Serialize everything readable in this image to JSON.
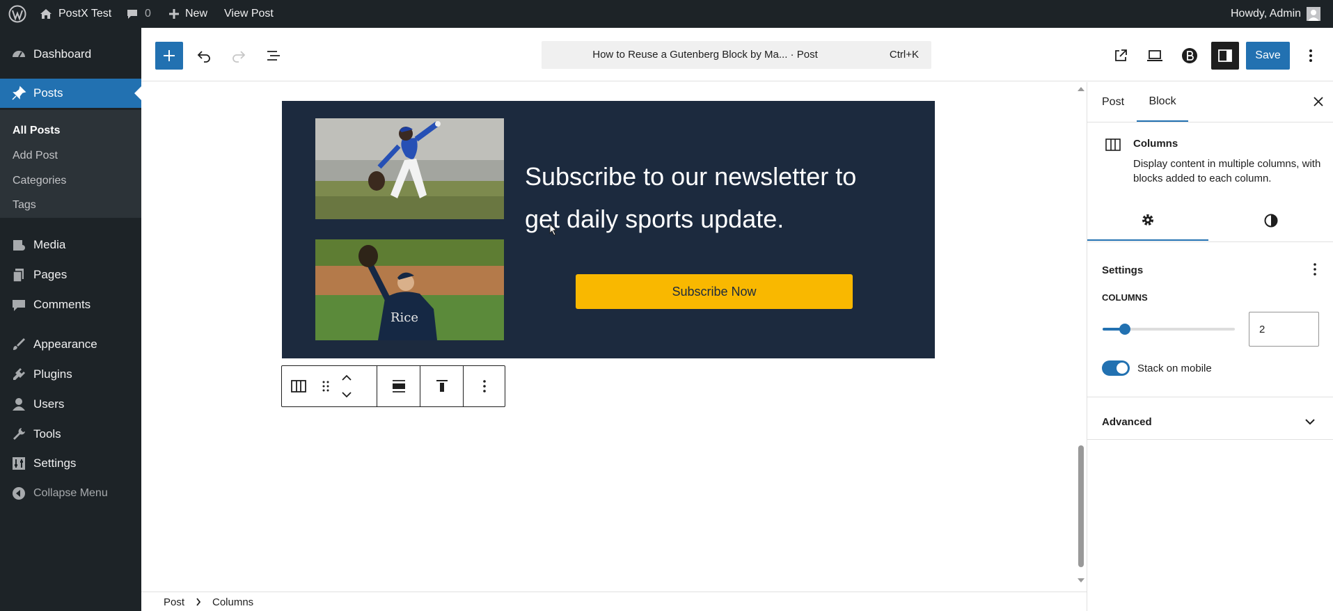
{
  "admin_bar": {
    "site_name": "PostX Test",
    "comments_count": "0",
    "new_label": "New",
    "view_post_label": "View Post",
    "greeting": "Howdy, Admin"
  },
  "admin_menu": {
    "items": [
      {
        "label": "Dashboard",
        "icon": "dashboard-icon"
      },
      {
        "label": "Posts",
        "icon": "pin-icon",
        "current": true
      },
      {
        "label": "Media",
        "icon": "media-icon"
      },
      {
        "label": "Pages",
        "icon": "pages-icon"
      },
      {
        "label": "Comments",
        "icon": "comment-icon"
      },
      {
        "label": "Appearance",
        "icon": "brush-icon"
      },
      {
        "label": "Plugins",
        "icon": "plugin-icon"
      },
      {
        "label": "Users",
        "icon": "user-icon"
      },
      {
        "label": "Tools",
        "icon": "wrench-icon"
      },
      {
        "label": "Settings",
        "icon": "sliders-icon"
      },
      {
        "label": "Collapse Menu",
        "icon": "collapse-icon"
      }
    ],
    "posts_submenu": [
      "All Posts",
      "Add Post",
      "Categories",
      "Tags"
    ]
  },
  "editor_header": {
    "document_title": "How to Reuse a Gutenberg Block by Ma... · Post",
    "shortcut": "Ctrl+K",
    "save_label": "Save"
  },
  "canvas": {
    "headline": "Subscribe to our newsletter to get daily sports update.",
    "button_label": "Subscribe Now",
    "colors": {
      "cover_background": "#1c2a3e",
      "button_background": "#f9b800",
      "accent": "#2271b1"
    }
  },
  "sidebar": {
    "tabs": [
      "Post",
      "Block"
    ],
    "active_tab": "Block",
    "block_name": "Columns",
    "block_description": "Display content in multiple columns, with blocks added to each column.",
    "settings_title": "Settings",
    "columns_label": "COLUMNS",
    "columns_value": "2",
    "columns_slider_fraction": 0.17,
    "stack_on_mobile_label": "Stack on mobile",
    "stack_on_mobile_enabled": true,
    "advanced_label": "Advanced"
  },
  "breadcrumb": {
    "items": [
      "Post",
      "Columns"
    ]
  }
}
